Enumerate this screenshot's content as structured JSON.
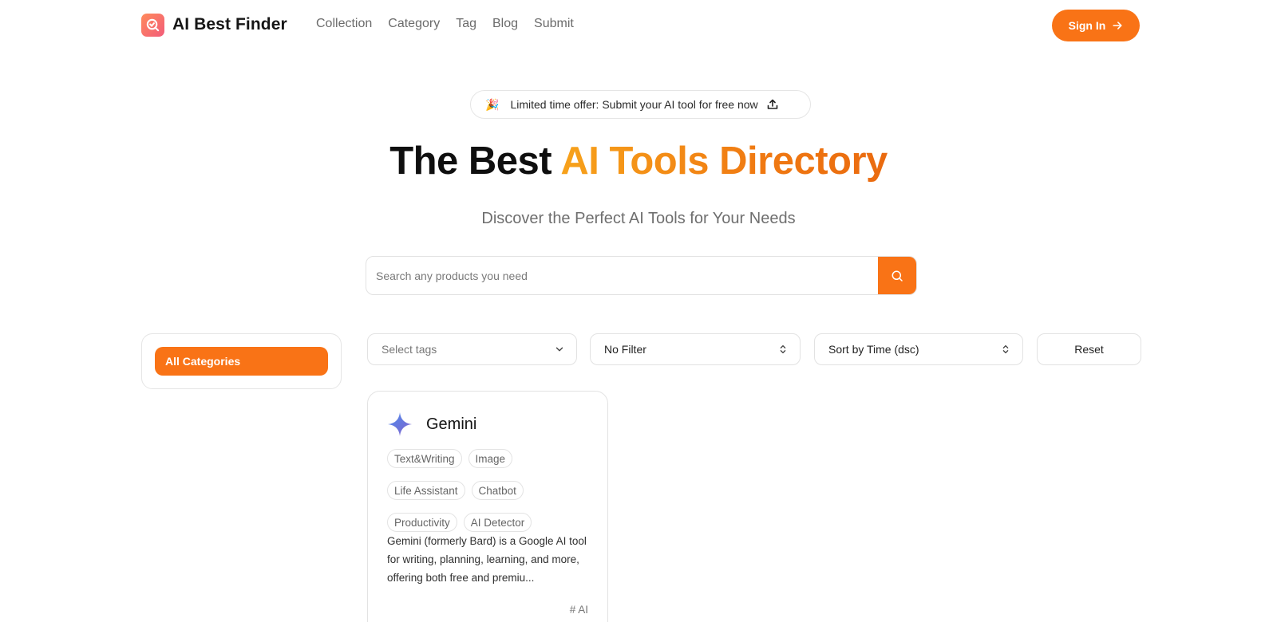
{
  "header": {
    "brand": "AI Best Finder",
    "nav": [
      "Collection",
      "Category",
      "Tag",
      "Blog",
      "Submit"
    ],
    "signin_label": "Sign In"
  },
  "offer": {
    "emoji": "🎉",
    "text": "Limited time offer: Submit your AI tool for free now"
  },
  "hero": {
    "title_plain": "The Best ",
    "title_accent": "AI Tools Directory",
    "subtitle": "Discover the Perfect AI Tools for Your Needs"
  },
  "search": {
    "placeholder": "Search any products you need"
  },
  "sidebar": {
    "active_category": "All Categories"
  },
  "filters": {
    "tags_placeholder": "Select tags",
    "filter_value": "No Filter",
    "sort_value": "Sort by Time (dsc)",
    "reset_label": "Reset"
  },
  "card": {
    "title": "Gemini",
    "tags": [
      "Text&Writing",
      "Image",
      "Life Assistant",
      "Chatbot",
      "Productivity",
      "AI Detector"
    ],
    "description": "Gemini (formerly Bard) is a Google AI tool for writing, planning, learning, and more, offering both free and premiu...",
    "hashtag": "# AI"
  },
  "colors": {
    "accent": "#f97316",
    "border": "#e3e3e3",
    "text_muted": "#6b6b6b"
  }
}
